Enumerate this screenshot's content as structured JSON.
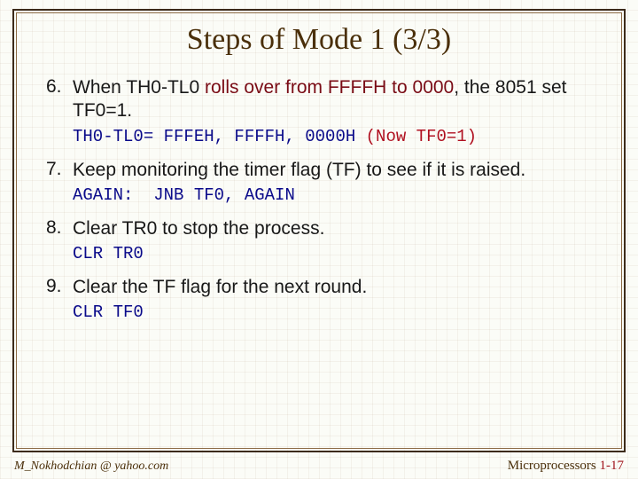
{
  "title": "Steps of Mode 1 (3/3)",
  "steps": [
    {
      "num": "6.",
      "text_pre": "When TH0-TL0 ",
      "text_roll": "rolls over from FFFFH to 0000",
      "text_post": ", the 8051 set TF0=1.",
      "code_plain": "TH0-TL0= FFFEH, FFFFH, 0000H ",
      "code_red": "(Now TF0=1)"
    },
    {
      "num": "7.",
      "text_pre": "Keep monitoring the timer flag (TF) to see if it is raised.",
      "text_roll": "",
      "text_post": "",
      "code_plain": "AGAIN:  JNB TF0, AGAIN",
      "code_red": ""
    },
    {
      "num": "8.",
      "text_pre": "Clear TR0 to stop the process.",
      "text_roll": "",
      "text_post": "",
      "code_plain": "CLR TR0",
      "code_red": ""
    },
    {
      "num": "9.",
      "text_pre": "Clear the TF flag for the next round.",
      "text_roll": "",
      "text_post": "",
      "code_plain": "CLR TF0",
      "code_red": ""
    }
  ],
  "footer": {
    "left": "M_Nokhodchian @ yahoo.com",
    "right_label": "Microprocessors ",
    "right_page": "1-17"
  }
}
